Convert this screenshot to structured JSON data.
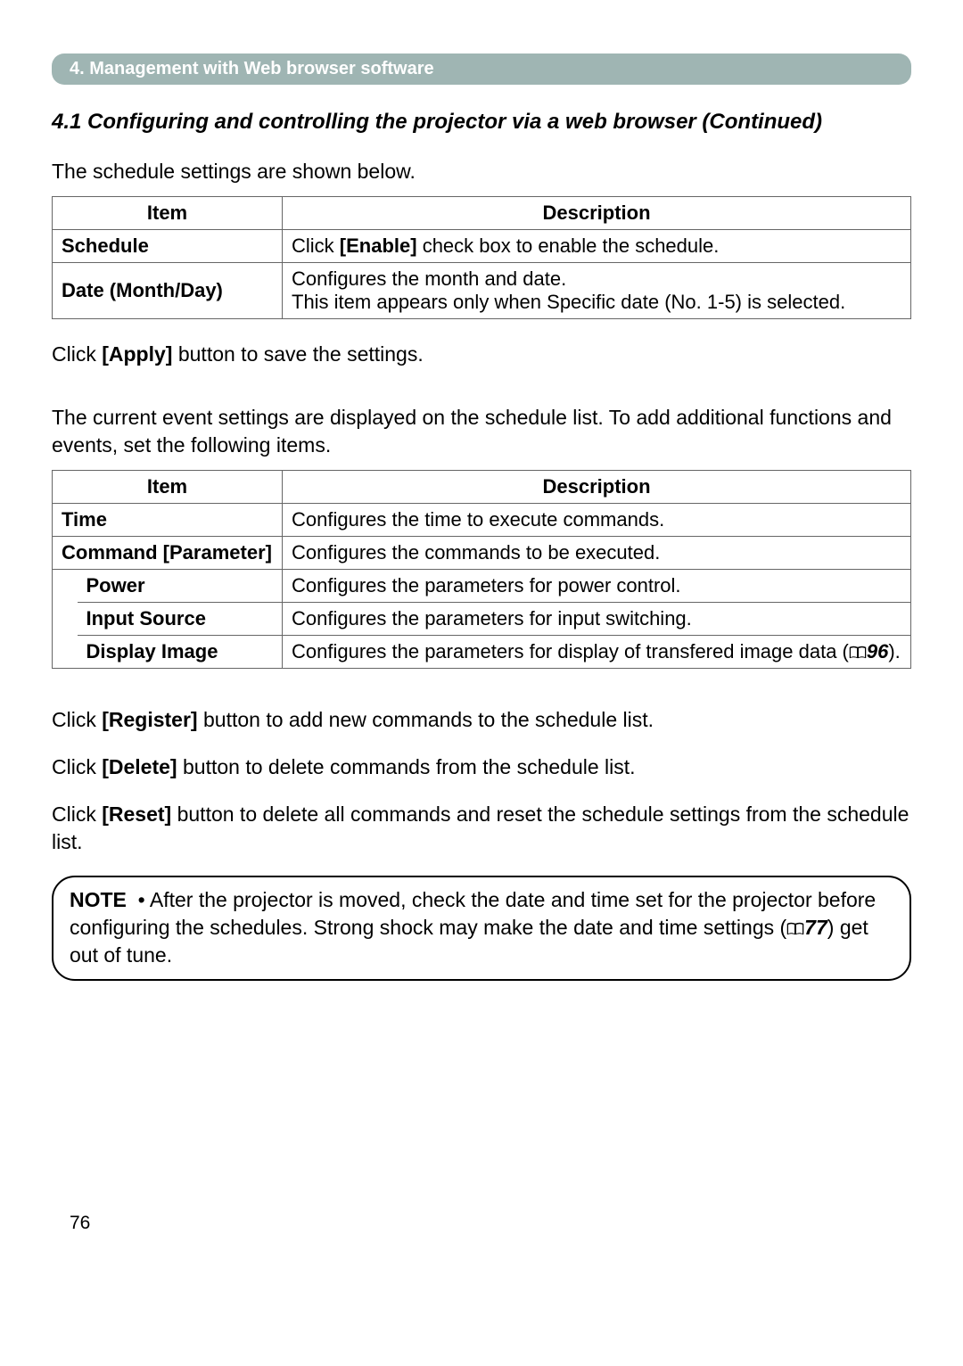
{
  "header": {
    "chapter": "4. Management with Web browser software"
  },
  "section": {
    "title": "4.1 Configuring and controlling the projector via a web browser (Continued)"
  },
  "intro1": "The schedule settings are shown below.",
  "table1": {
    "headers": {
      "item": "Item",
      "desc": "Description"
    },
    "rows": [
      {
        "item": "Schedule",
        "desc_pre": "Click ",
        "desc_bold": "[Enable]",
        "desc_post": " check box to enable the schedule."
      },
      {
        "item": "Date (Month/Day)",
        "desc": "Configures the month and date.\nThis item appears only when Specific date (No. 1-5) is selected."
      }
    ]
  },
  "apply_line": {
    "pre": "Click ",
    "bold": "[Apply]",
    "post": " button to save the settings."
  },
  "intro2": "The current event settings are displayed on the schedule list. To add additional functions and events, set the following items.",
  "table2": {
    "headers": {
      "item": "Item",
      "desc": "Description"
    },
    "rows": {
      "time": {
        "item": "Time",
        "desc": "Configures the time to execute commands."
      },
      "command": {
        "item": "Command [Parameter]",
        "desc": "Configures the commands to be executed."
      },
      "power": {
        "item": "Power",
        "desc": "Configures the parameters for power control."
      },
      "input": {
        "item": "Input Source",
        "desc": "Configures the parameters for input switching."
      },
      "display": {
        "item": "Display Image",
        "desc_pre": "Configures the parameters for display of transfered image data (",
        "desc_ref": "96",
        "desc_post": ")."
      }
    }
  },
  "register_line": {
    "pre": "Click ",
    "bold": "[Register]",
    "post": " button to add new commands to the schedule list."
  },
  "delete_line": {
    "pre": "Click ",
    "bold": "[Delete]",
    "post": " button to delete commands from the schedule list."
  },
  "reset_line": {
    "pre": "Click ",
    "bold": "[Reset]",
    "post": " button to delete all commands and reset the schedule settings from the schedule list."
  },
  "note": {
    "label": "NOTE",
    "bullet": "•",
    "text_pre": " After the projector is moved, check the date and time set for the projector before configuring the schedules. Strong shock may make the date and time settings (",
    "text_ref": "77",
    "text_post": ") get out of tune."
  },
  "page_number": "76"
}
